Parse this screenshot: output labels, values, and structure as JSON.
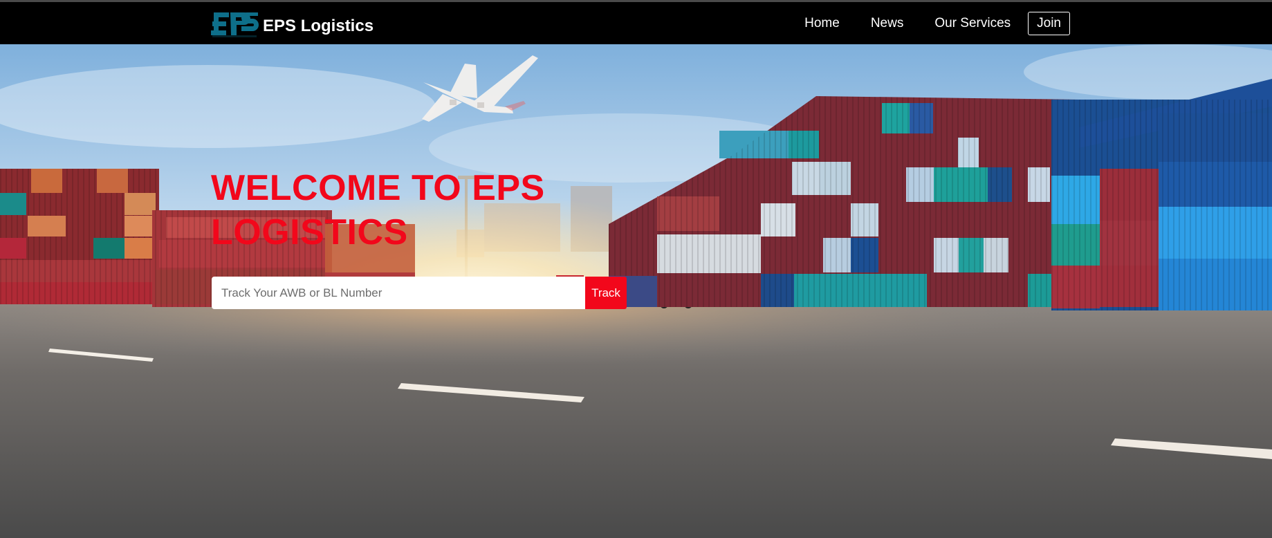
{
  "brand": {
    "name": "EPS Logistics",
    "logo_text": "EPS",
    "logo_color": "#0e6f8a"
  },
  "nav": {
    "items": [
      {
        "label": "Home"
      },
      {
        "label": "News"
      },
      {
        "label": "Our Services"
      }
    ],
    "join_label": "Join"
  },
  "hero": {
    "title": "WELCOME TO EPS LOGISTICS",
    "accent_color": "#f2071b",
    "background": "shipping container yard with trucks and airplane"
  },
  "tracking": {
    "placeholder": "Track Your AWB or BL Number",
    "button_label": "Track"
  }
}
